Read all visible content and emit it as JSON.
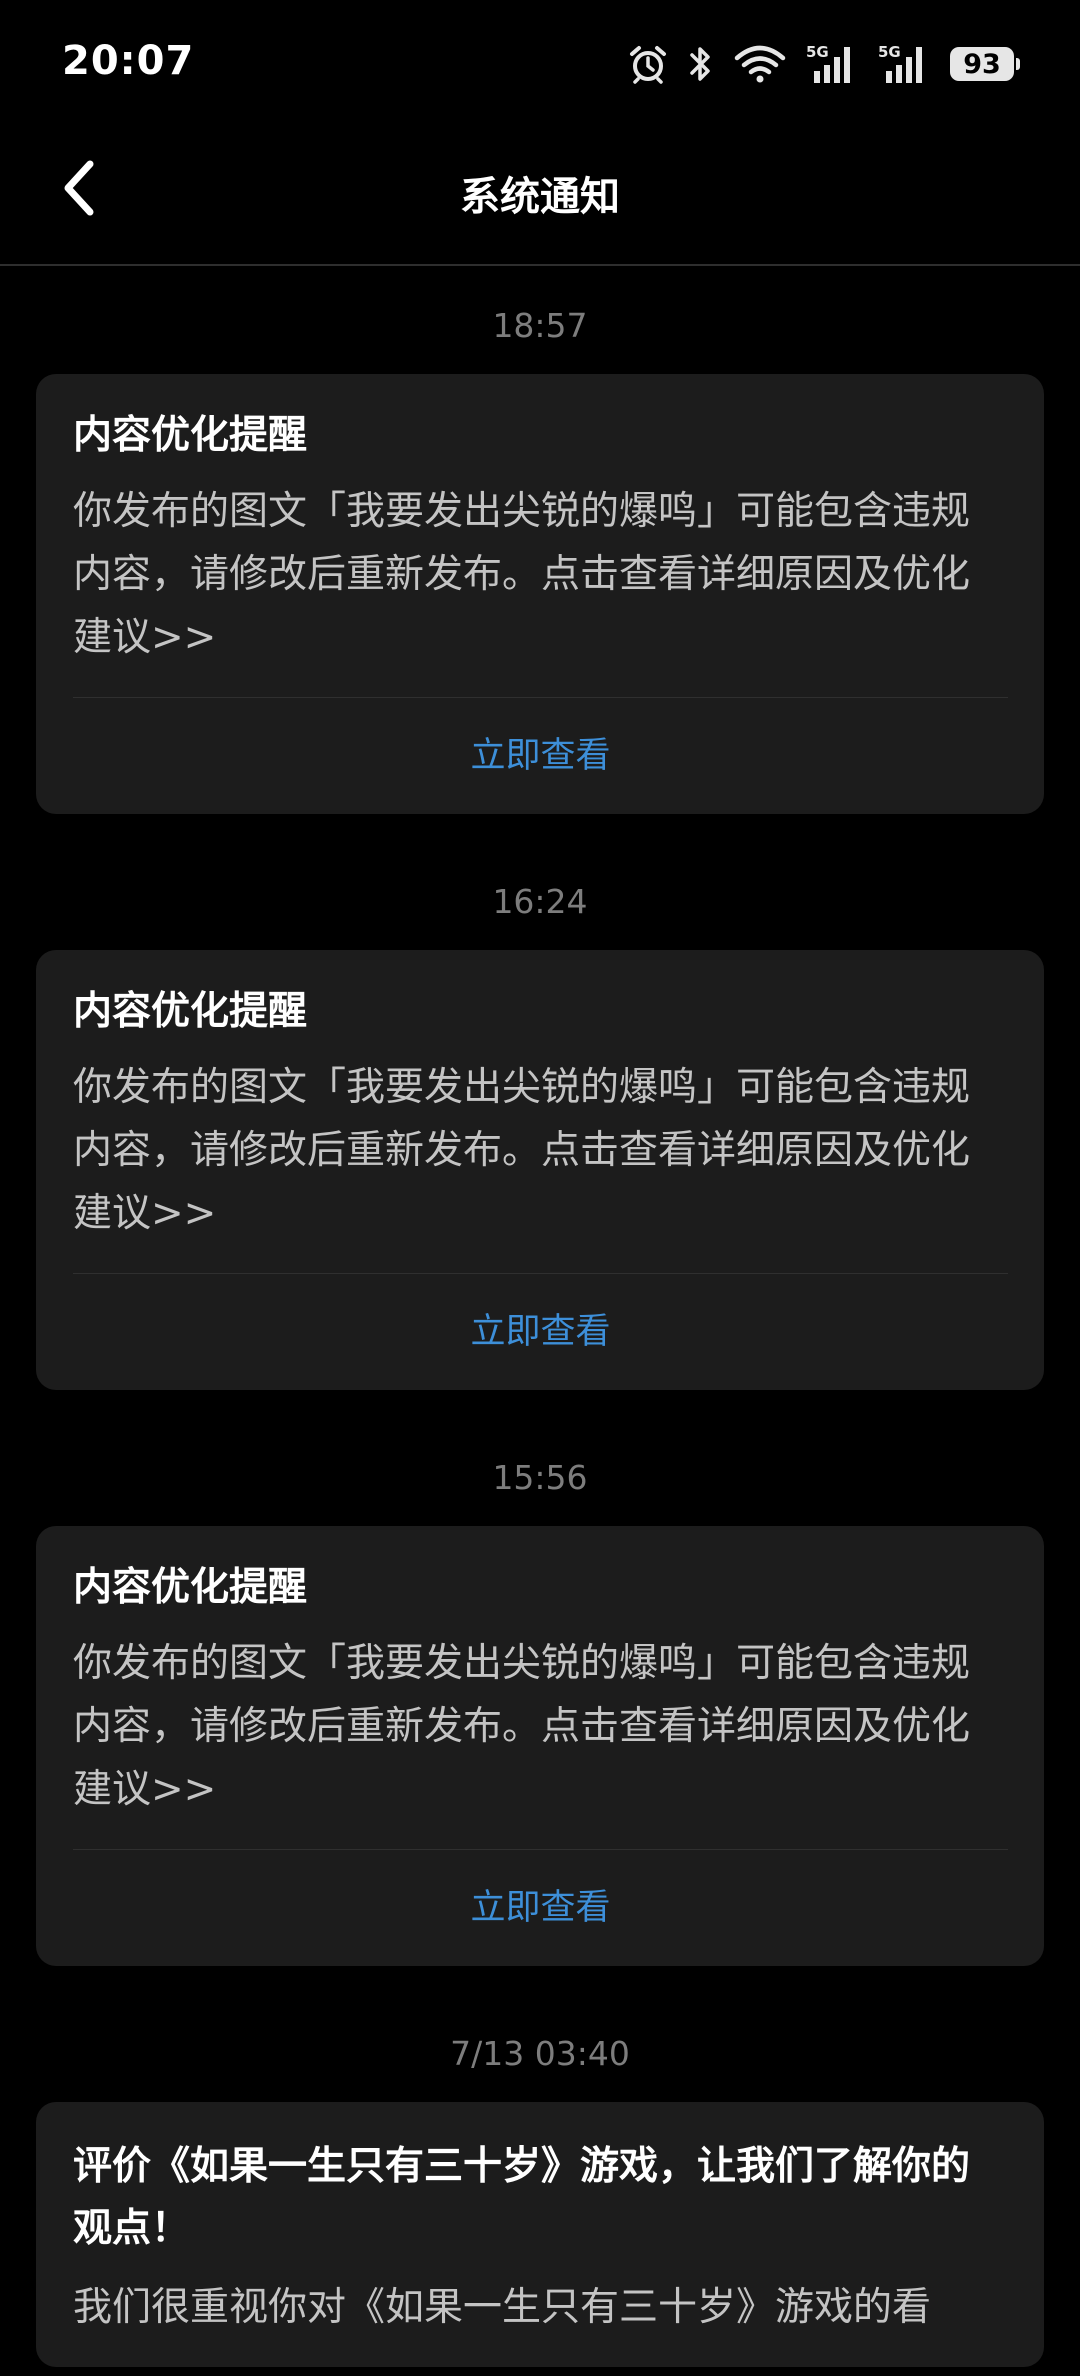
{
  "status_bar": {
    "time": "20:07",
    "battery": "93",
    "icons": [
      "alarm-icon",
      "bluetooth-icon",
      "wifi-icon",
      "signal-5g-icon",
      "signal-5g-icon",
      "battery-icon"
    ]
  },
  "header": {
    "title": "系统通知",
    "back_icon": "chevron-left-icon"
  },
  "colors": {
    "background": "#000000",
    "card": "#1c1c1c",
    "accent": "#3d8fd9",
    "muted": "#7d7d7d"
  },
  "notifications": [
    {
      "time": "18:57",
      "title": "内容优化提醒",
      "body": "你发布的图文「我要发出尖锐的爆鸣」可能包含违规内容，请修改后重新发布。点击查看详细原因及优化建议>>",
      "action": "立即查看"
    },
    {
      "time": "16:24",
      "title": "内容优化提醒",
      "body": "你发布的图文「我要发出尖锐的爆鸣」可能包含违规内容，请修改后重新发布。点击查看详细原因及优化建议>>",
      "action": "立即查看"
    },
    {
      "time": "15:56",
      "title": "内容优化提醒",
      "body": "你发布的图文「我要发出尖锐的爆鸣」可能包含违规内容，请修改后重新发布。点击查看详细原因及优化建议>>",
      "action": "立即查看"
    },
    {
      "time": "7/13  03:40",
      "title": "评价《如果一生只有三十岁》游戏，让我们了解你的观点！",
      "body": "我们很重视你对《如果一生只有三十岁》游戏的看"
    }
  ]
}
